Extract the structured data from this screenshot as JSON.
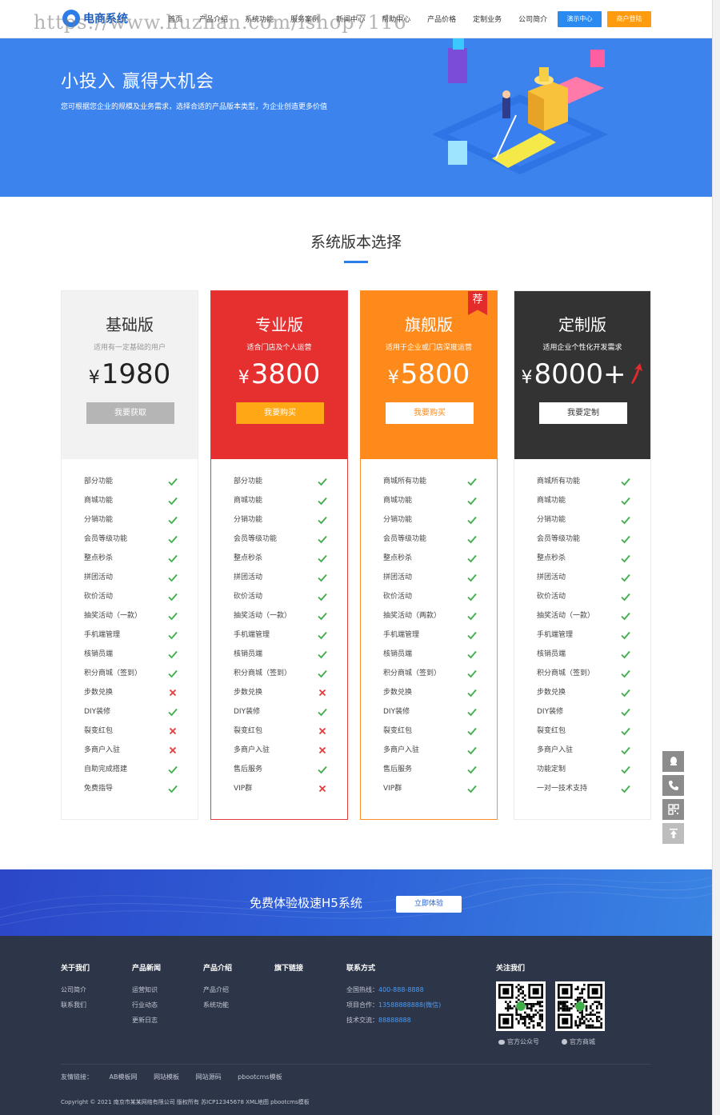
{
  "header": {
    "logo_text": "电商系统",
    "watermark": "https://www.huzhan.com/ishop7116",
    "nav": [
      "首页",
      "产品介绍",
      "系统功能",
      "服务案例",
      "新闻中心",
      "帮助中心",
      "产品价格",
      "定制业务",
      "公司简介"
    ],
    "demo_button": "演示中心",
    "login_button": "商户登陆"
  },
  "banner": {
    "title": "小投入 赢得大机会",
    "description": "您可根据您企业的规模及业务需求，选择合适的产品版本类型，为企业创造更多价值"
  },
  "section": {
    "title": "系统版本选择"
  },
  "plans": [
    {
      "name": "基础版",
      "subtitle": "适用有一定基础的用户",
      "currency": "¥",
      "price": "1980",
      "button": "我要获取",
      "features": [
        {
          "label": "部分功能",
          "ok": true
        },
        {
          "label": "商城功能",
          "ok": true
        },
        {
          "label": "分销功能",
          "ok": true
        },
        {
          "label": "会员等级功能",
          "ok": true
        },
        {
          "label": "整点秒杀",
          "ok": true
        },
        {
          "label": "拼团活动",
          "ok": true
        },
        {
          "label": "砍价活动",
          "ok": true
        },
        {
          "label": "抽奖活动（一款）",
          "ok": true
        },
        {
          "label": "手机端管理",
          "ok": true
        },
        {
          "label": "核销员端",
          "ok": true
        },
        {
          "label": "积分商城（签到）",
          "ok": true
        },
        {
          "label": "步数兑换",
          "ok": false
        },
        {
          "label": "DIY装修",
          "ok": true
        },
        {
          "label": "裂变红包",
          "ok": false
        },
        {
          "label": "多商户入驻",
          "ok": false
        },
        {
          "label": "自助完成搭建",
          "ok": true
        },
        {
          "label": "免费指导",
          "ok": true
        }
      ]
    },
    {
      "name": "专业版",
      "subtitle": "适合门店及个人运营",
      "currency": "¥",
      "price": "3800",
      "button": "我要购买",
      "features": [
        {
          "label": "部分功能",
          "ok": true
        },
        {
          "label": "商城功能",
          "ok": true
        },
        {
          "label": "分销功能",
          "ok": true
        },
        {
          "label": "会员等级功能",
          "ok": true
        },
        {
          "label": "整点秒杀",
          "ok": true
        },
        {
          "label": "拼团活动",
          "ok": true
        },
        {
          "label": "砍价活动",
          "ok": true
        },
        {
          "label": "抽奖活动（一款）",
          "ok": true
        },
        {
          "label": "手机端管理",
          "ok": true
        },
        {
          "label": "核销员端",
          "ok": true
        },
        {
          "label": "积分商城（签到）",
          "ok": true
        },
        {
          "label": "步数兑换",
          "ok": false
        },
        {
          "label": "DIY装修",
          "ok": true
        },
        {
          "label": "裂变红包",
          "ok": false
        },
        {
          "label": "多商户入驻",
          "ok": false
        },
        {
          "label": "售后服务",
          "ok": true
        },
        {
          "label": "VIP群",
          "ok": false
        }
      ]
    },
    {
      "name": "旗舰版",
      "subtitle": "适用于企业或门店深度运营",
      "currency": "¥",
      "price": "5800",
      "button": "我要购买",
      "badge": "荐",
      "features": [
        {
          "label": "商城所有功能",
          "ok": true
        },
        {
          "label": "商城功能",
          "ok": true
        },
        {
          "label": "分销功能",
          "ok": true
        },
        {
          "label": "会员等级功能",
          "ok": true
        },
        {
          "label": "整点秒杀",
          "ok": true
        },
        {
          "label": "拼团活动",
          "ok": true
        },
        {
          "label": "砍价活动",
          "ok": true
        },
        {
          "label": "抽奖活动（两款）",
          "ok": true
        },
        {
          "label": "手机端管理",
          "ok": true
        },
        {
          "label": "核销员端",
          "ok": true
        },
        {
          "label": "积分商城（签到）",
          "ok": true
        },
        {
          "label": "步数兑换",
          "ok": true
        },
        {
          "label": "DIY装修",
          "ok": true
        },
        {
          "label": "裂变红包",
          "ok": true
        },
        {
          "label": "多商户入驻",
          "ok": true
        },
        {
          "label": "售后服务",
          "ok": true
        },
        {
          "label": "VIP群",
          "ok": true
        }
      ]
    },
    {
      "name": "定制版",
      "subtitle": "适用企业个性化开发需求",
      "currency": "¥",
      "price": "8000+",
      "button": "我要定制",
      "features": [
        {
          "label": "商城所有功能",
          "ok": true
        },
        {
          "label": "商城功能",
          "ok": true
        },
        {
          "label": "分销功能",
          "ok": true
        },
        {
          "label": "会员等级功能",
          "ok": true
        },
        {
          "label": "整点秒杀",
          "ok": true
        },
        {
          "label": "拼团活动",
          "ok": true
        },
        {
          "label": "砍价活动",
          "ok": true
        },
        {
          "label": "抽奖活动（一款）",
          "ok": true
        },
        {
          "label": "手机端管理",
          "ok": true
        },
        {
          "label": "核销员端",
          "ok": true
        },
        {
          "label": "积分商城（签到）",
          "ok": true
        },
        {
          "label": "步数兑换",
          "ok": true
        },
        {
          "label": "DIY装修",
          "ok": true
        },
        {
          "label": "裂变红包",
          "ok": true
        },
        {
          "label": "多商户入驻",
          "ok": true
        },
        {
          "label": "功能定制",
          "ok": true
        },
        {
          "label": "一对一技术支持",
          "ok": true
        }
      ]
    }
  ],
  "cta": {
    "text": "免费体验极速H5系统",
    "button": "立即体验"
  },
  "footer": {
    "about": {
      "title": "关于我们",
      "items": [
        "公司简介",
        "联系我们"
      ]
    },
    "news": {
      "title": "产品新闻",
      "items": [
        "运营知识",
        "行业动态",
        "更新日志"
      ]
    },
    "product": {
      "title": "产品介绍",
      "items": [
        "产品介绍",
        "系统功能"
      ]
    },
    "links_col": {
      "title": "旗下链接"
    },
    "contact": {
      "title": "联系方式",
      "hotline_label": "全国热线：",
      "hotline": "400-888-8888",
      "coop_label": "项目合作：",
      "coop": "13588888888(微信)",
      "tech_label": "技术交流：",
      "tech": "88888888"
    },
    "follow": {
      "title": "关注我们",
      "qr1_label": "官方公众号",
      "qr2_label": "官方商城"
    },
    "friend_links_label": "友情链接：",
    "friend_links": [
      "AB模板网",
      "网站模板",
      "网站源码",
      "pbootcms模板"
    ],
    "copyright": "Copyright © 2021 南京市某某网络有限公司 版权所有 苏ICP12345678 XML地图 pbootcms模板"
  },
  "colors": {
    "primary": "#3c83ee",
    "red": "#e62f2f",
    "orange": "#fd8a1a",
    "dark": "#333333",
    "check": "#3fae4a",
    "cross": "#e03b3b"
  }
}
